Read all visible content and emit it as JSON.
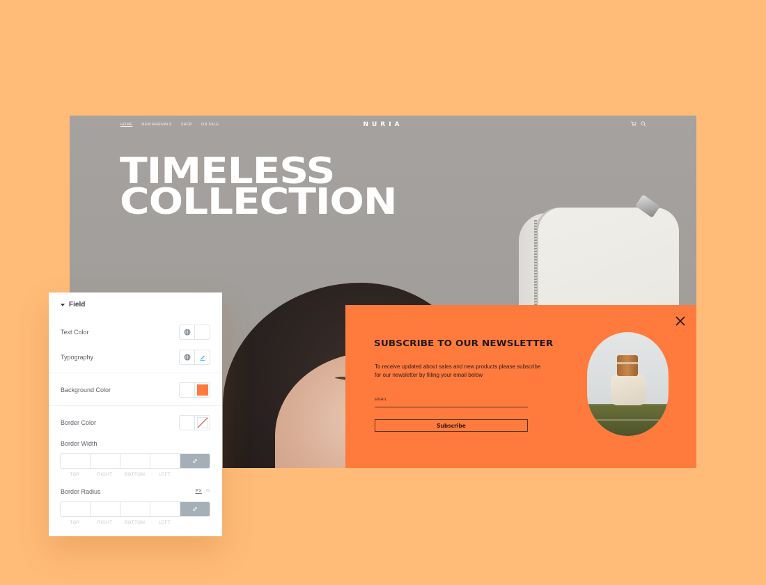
{
  "site": {
    "nav": [
      "HOME",
      "NEW ARRIVALS",
      "SHOP",
      "ON SALE"
    ],
    "logo": "NURIA",
    "icons": [
      "cart-icon",
      "search-icon"
    ],
    "hero_title_line1": "TIMELESS",
    "hero_title_line2": "COLLECTION"
  },
  "popup": {
    "title": "SUBSCRIBE TO OUR NEWSLETTER",
    "description": "To receive updated about sales and new products please subscribe for our newsletter by filling your email below",
    "email_label": "EMAIL",
    "email_value": "",
    "button_label": "Subscribe",
    "close_icon": "close-icon",
    "background_color": "#ff7a3d"
  },
  "panel": {
    "section_title": "Field",
    "text_color_label": "Text Color",
    "typography_label": "Typography",
    "background_color_label": "Background Color",
    "background_color_value": "#ff7a3d",
    "border_color_label": "Border Color",
    "border_width_label": "Border Width",
    "border_radius_label": "Border Radius",
    "unit_px": "PX",
    "unit_pct": "%",
    "dimension_labels": [
      "TOP",
      "RIGHT",
      "BOTTOM",
      "LEFT"
    ],
    "border_width_values": [
      "",
      "",
      "",
      ""
    ],
    "border_radius_values": [
      "",
      "",
      "",
      ""
    ]
  },
  "colors": {
    "page_background": "#ffbb78",
    "accent": "#ff7a3d",
    "link_button": "#a4afb7"
  }
}
